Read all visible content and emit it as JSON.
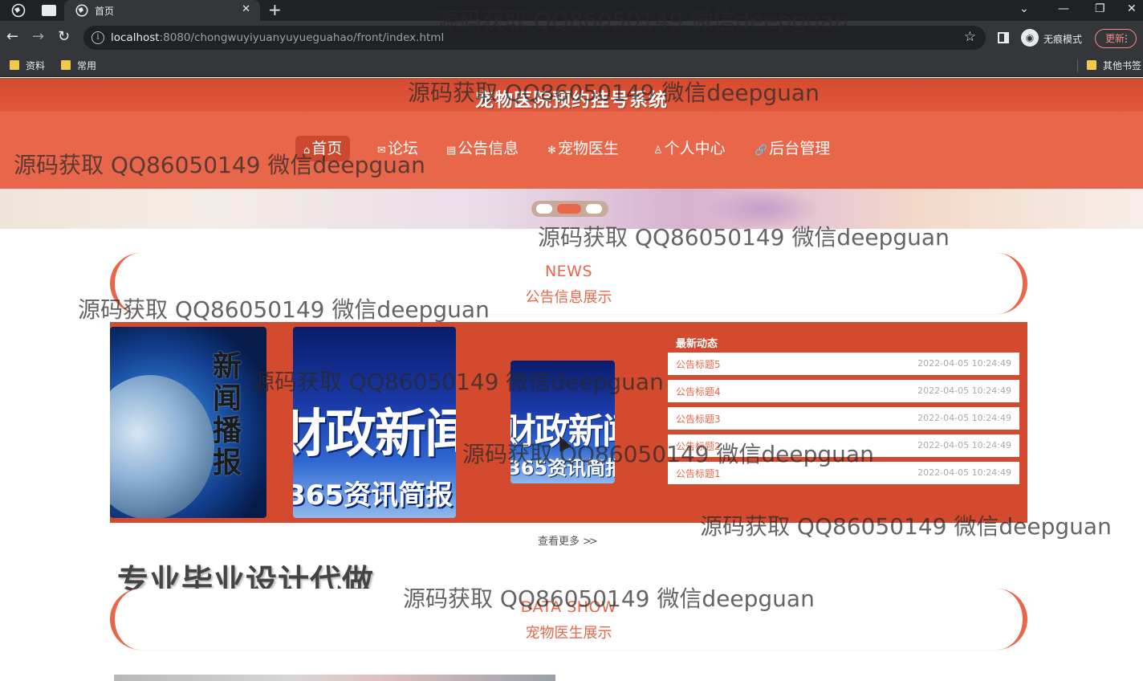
{
  "browser": {
    "tab_title": "首页",
    "url_host": "localhost",
    "url_rest": ":8080/chongwuyiyuanyuyueguahao/front/index.html",
    "incognito_label": "无痕模式",
    "update_label": "更新",
    "bookmarks": [
      "资料",
      "常用"
    ],
    "other_bookmarks": "其他书签"
  },
  "site": {
    "title": "宠物医院预约挂号系统",
    "nav": [
      {
        "icon": "⌂",
        "label": "首页"
      },
      {
        "icon": "✉",
        "label": "论坛"
      },
      {
        "icon": "▤",
        "label": "公告信息"
      },
      {
        "icon": "✻",
        "label": "宠物医生"
      },
      {
        "icon": "♙",
        "label": "个人中心"
      },
      {
        "icon": "🔗",
        "label": "后台管理"
      }
    ]
  },
  "news_section": {
    "en": "NEWS",
    "cn": "公告信息展示",
    "image1_text": "新闻播报",
    "image2_main": "财政新闻",
    "image2_sub": "365资讯简报",
    "latest_title": "最新动态",
    "items": [
      {
        "title": "公告标题5",
        "date": "2022-04-05 10:24:49"
      },
      {
        "title": "公告标题4",
        "date": "2022-04-05 10:24:49"
      },
      {
        "title": "公告标题3",
        "date": "2022-04-05 10:24:49"
      },
      {
        "title": "公告标题2",
        "date": "2022-04-05 10:24:49"
      },
      {
        "title": "公告标题1",
        "date": "2022-04-05 10:24:49"
      }
    ],
    "more": "查看更多"
  },
  "ad_text": "专业毕业设计代做",
  "doctor_section": {
    "en": "DATA SHOW",
    "cn": "宠物医生展示"
  },
  "watermark": "源码获取 QQ86050149 微信deepguan"
}
